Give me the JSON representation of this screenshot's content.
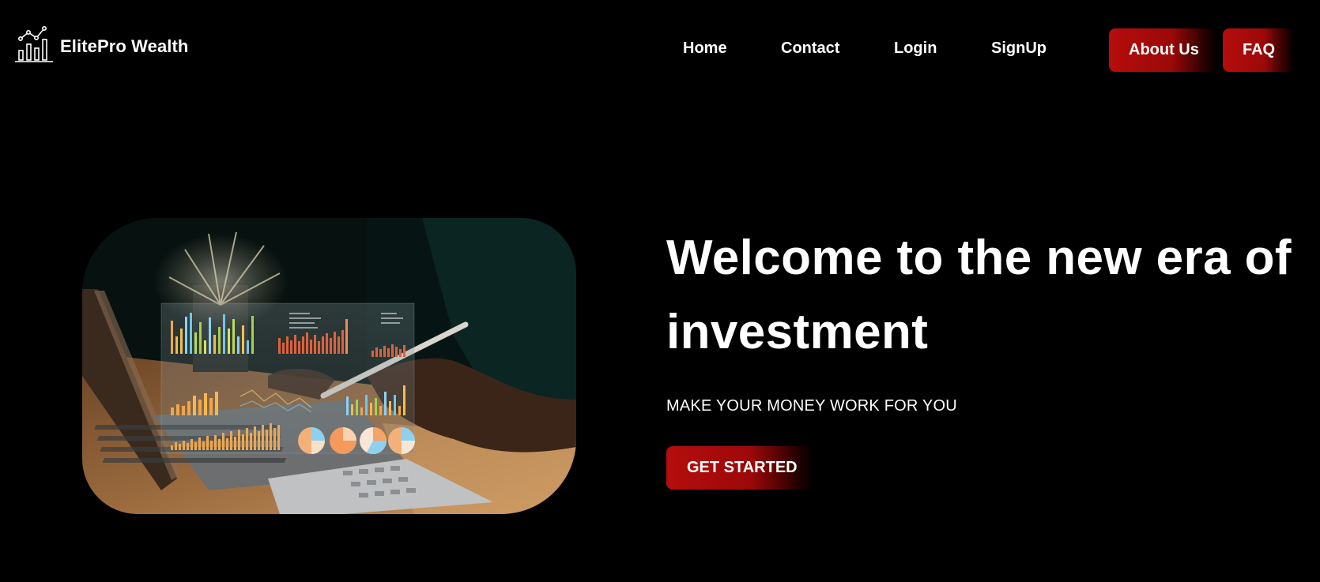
{
  "brand": {
    "name": "ElitePro Wealth",
    "icon": "bar-chart-trend-icon"
  },
  "nav": {
    "links": [
      {
        "label": "Home"
      },
      {
        "label": "Contact"
      },
      {
        "label": "Login"
      },
      {
        "label": "SignUp"
      }
    ],
    "buttons": [
      {
        "label": "About Us"
      },
      {
        "label": "FAQ"
      }
    ]
  },
  "hero": {
    "title": "Welcome to the new era of investment",
    "subtitle": "MAKE YOUR MONEY WORK FOR YOU",
    "cta_label": "GET STARTED",
    "image": "laptop-analytics-dashboard-photo"
  },
  "colors": {
    "background": "#000000",
    "accent": "#b50d0d",
    "text": "#ffffff"
  }
}
